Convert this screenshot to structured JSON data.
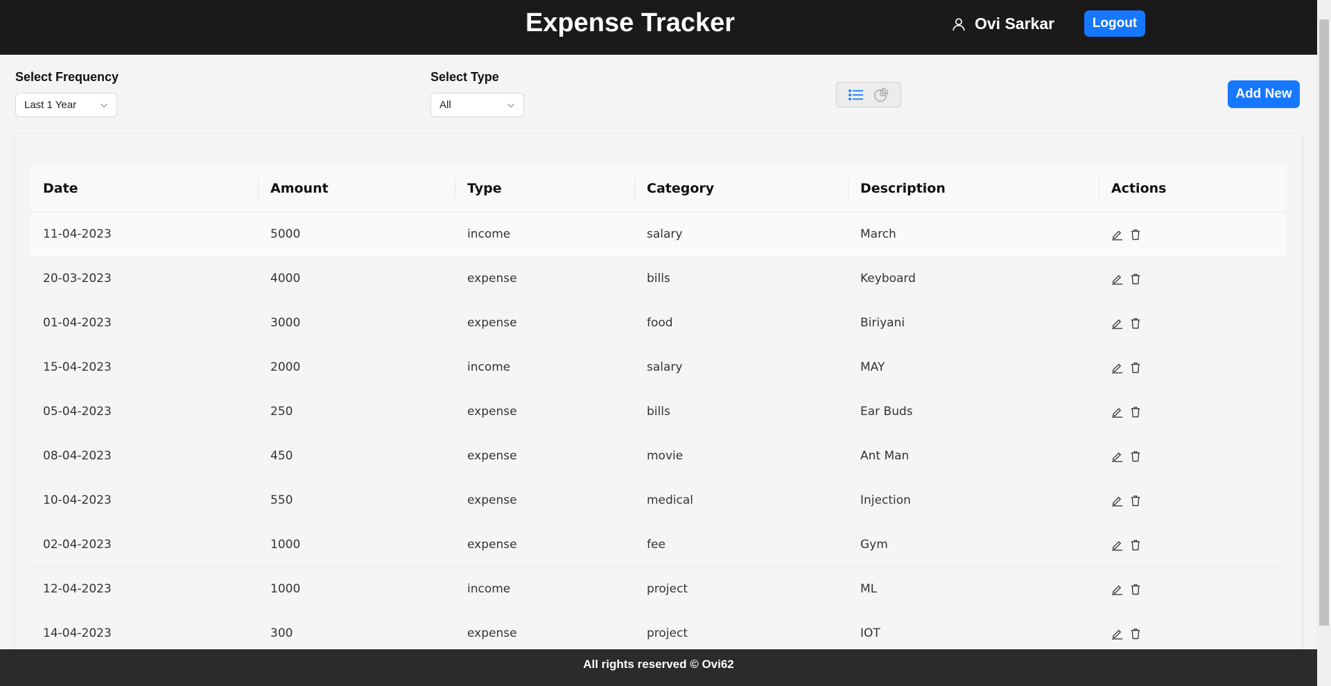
{
  "header": {
    "title": "Expense Tracker",
    "user_name": "Ovi Sarkar",
    "logout_label": "Logout"
  },
  "filters": {
    "frequency_label": "Select Frequency",
    "frequency_value": "Last 1 Year",
    "type_label": "Select Type",
    "type_value": "All"
  },
  "view_toggle": {
    "list_icon": "list-icon",
    "chart_icon": "pie-chart-icon",
    "active": "list"
  },
  "add_new_label": "Add New",
  "table": {
    "columns": [
      "Date",
      "Amount",
      "Type",
      "Category",
      "Description",
      "Actions"
    ],
    "rows": [
      [
        "11-04-2023",
        "5000",
        "income",
        "salary",
        "March"
      ],
      [
        "20-03-2023",
        "4000",
        "expense",
        "bills",
        "Keyboard"
      ],
      [
        "01-04-2023",
        "3000",
        "expense",
        "food",
        "Biriyani"
      ],
      [
        "15-04-2023",
        "2000",
        "income",
        "salary",
        "MAY"
      ],
      [
        "05-04-2023",
        "250",
        "expense",
        "bills",
        "Ear Buds"
      ],
      [
        "08-04-2023",
        "450",
        "expense",
        "movie",
        "Ant Man"
      ],
      [
        "10-04-2023",
        "550",
        "expense",
        "medical",
        "Injection"
      ],
      [
        "02-04-2023",
        "1000",
        "expense",
        "fee",
        "Gym"
      ],
      [
        "12-04-2023",
        "1000",
        "income",
        "project",
        "ML"
      ],
      [
        "14-04-2023",
        "300",
        "expense",
        "project",
        "IOT"
      ]
    ]
  },
  "footer": {
    "text": "All rights reserved © Ovi62"
  },
  "colors": {
    "accent": "#1677ff",
    "header_bg": "#1a1a1a",
    "footer_bg": "#2b2b2b"
  }
}
